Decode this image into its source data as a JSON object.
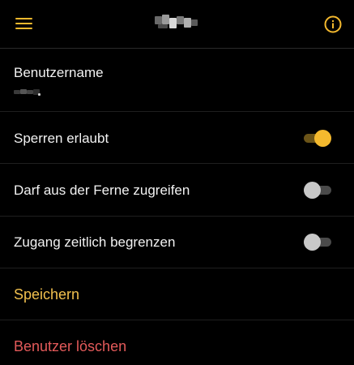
{
  "header": {
    "menu_icon": "hamburger-menu-icon",
    "info_icon": "info-circle-icon",
    "accent_color": "#f4b92e"
  },
  "settings": {
    "username_label": "Benutzername",
    "lock_allowed_label": "Sperren erlaubt",
    "lock_allowed_value": true,
    "remote_access_label": "Darf aus der Ferne zugreifen",
    "remote_access_value": false,
    "time_limit_label": "Zugang zeitlich begrenzen",
    "time_limit_value": false
  },
  "actions": {
    "save_label": "Speichern",
    "save_color": "#f1c04e",
    "delete_label": "Benutzer löschen",
    "delete_color": "#e35a5a"
  }
}
